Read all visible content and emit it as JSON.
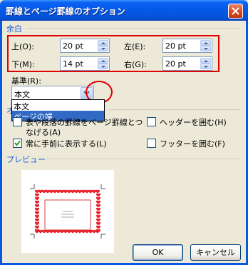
{
  "window": {
    "title": "罫線とページ罫線のオプション"
  },
  "margins": {
    "group_title": "余白",
    "top_label": "上(O):",
    "top_value": "20 pt",
    "left_label": "左(E):",
    "left_value": "20 pt",
    "bottom_label": "下(M):",
    "bottom_value": "14 pt",
    "right_label": "右(G):",
    "right_value": "20 pt"
  },
  "basis": {
    "label": "基準(R):",
    "selected": "本文",
    "options": [
      "本文",
      "ページの端"
    ]
  },
  "options": {
    "group_title_fragment": "オ",
    "surround_label_line1": "表や段落の罫線をページ罫線とつ",
    "surround_label_line2": "なげる(A)",
    "always_front_label": "常に手前に表示する(L)",
    "header_label": "ヘッダーを囲む(H)",
    "footer_label": "フッターを囲む(F)",
    "surround_checked": false,
    "always_front_checked": true,
    "header_checked": false,
    "footer_checked": false
  },
  "preview": {
    "group_title": "プレビュー"
  },
  "buttons": {
    "ok": "OK",
    "cancel": "キャンセル"
  },
  "colors": {
    "title_bar": "#0558e6",
    "group_title": "#2157d9",
    "annotation": "#e00000",
    "heart": "#e8202a"
  }
}
